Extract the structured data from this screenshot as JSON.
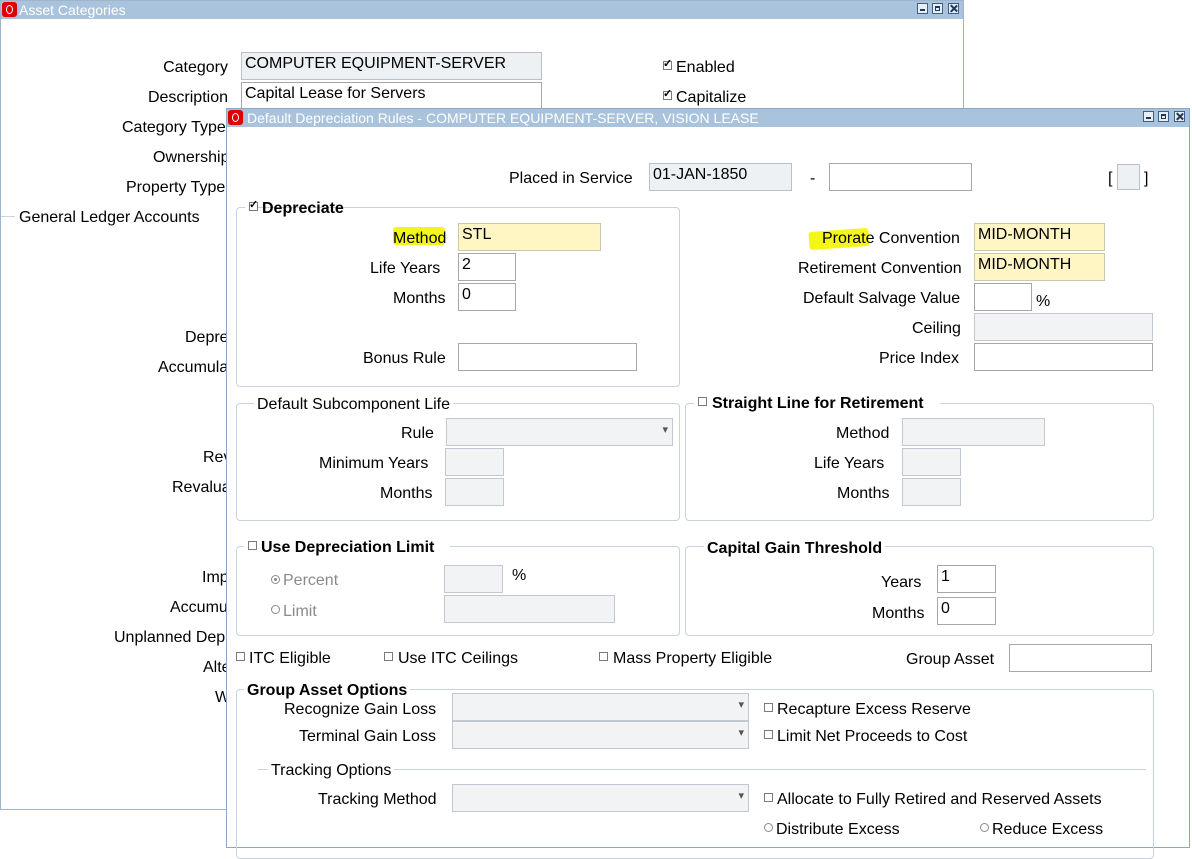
{
  "background_window": {
    "title": "Asset Categories",
    "fields": {
      "category_label": "Category",
      "category_value": "COMPUTER EQUIPMENT-SERVER",
      "description_label": "Description",
      "description_value": "Capital Lease for Servers",
      "category_type_label": "Category Type",
      "ownership_label": "Ownership",
      "property_type_label": "Property Type",
      "enabled_label": "Enabled",
      "capitalize_label": "Capitalize"
    },
    "section_general_ledger": "General Ledger Accounts",
    "partial_labels": [
      "Depre",
      "Accumula",
      "Rev",
      "Revalua",
      "Imp",
      "Accumu",
      "Unplanned Dep",
      "Alte",
      "W"
    ]
  },
  "dialog": {
    "title": "Default Depreciation Rules - COMPUTER EQUIPMENT-SERVER, VISION LEASE",
    "placed_in_service_label": "Placed in Service",
    "placed_in_service_from": "01-JAN-1850",
    "placed_in_service_sep": "-",
    "placed_in_service_to": "",
    "bracket_open": "[",
    "bracket_close": "]",
    "depreciate": {
      "label": "Depreciate",
      "checked": true,
      "method_label": "Method",
      "method_value": "STL",
      "life_years_label": "Life Years",
      "life_years_value": "2",
      "months_label": "Months",
      "months_value": "0",
      "bonus_rule_label": "Bonus Rule",
      "bonus_rule_value": ""
    },
    "prorate": {
      "prorate_label": "Prorate Convention",
      "prorate_value": "MID-MONTH",
      "retirement_label": "Retirement Convention",
      "retirement_value": "MID-MONTH",
      "salvage_label": "Default Salvage Value",
      "salvage_value": "",
      "percent_sign": "%",
      "ceiling_label": "Ceiling",
      "price_index_label": "Price Index"
    },
    "subcomponent": {
      "title": "Default Subcomponent Life",
      "rule_label": "Rule",
      "min_years_label": "Minimum Years",
      "months_label": "Months"
    },
    "straight_line": {
      "title": "Straight Line for Retirement",
      "method_label": "Method",
      "life_years_label": "Life Years",
      "months_label": "Months"
    },
    "dep_limit": {
      "title": "Use Depreciation Limit",
      "percent_label": "Percent",
      "limit_label": "Limit",
      "percent_sign": "%"
    },
    "capital_gain": {
      "title": "Capital Gain Threshold",
      "years_label": "Years",
      "years_value": "1",
      "months_label": "Months",
      "months_value": "0"
    },
    "checkboxes": {
      "itc_eligible": "ITC Eligible",
      "use_itc_ceilings": "Use ITC Ceilings",
      "mass_property": "Mass Property Eligible",
      "group_asset_label": "Group Asset"
    },
    "group_asset_options": {
      "title": "Group Asset Options",
      "recognize_label": "Recognize Gain Loss",
      "terminal_label": "Terminal Gain Loss",
      "recapture_label": "Recapture Excess Reserve",
      "limit_net_label": "Limit Net Proceeds  to Cost",
      "tracking_title": "Tracking Options",
      "tracking_method_label": "Tracking Method",
      "allocate_label": "Allocate to Fully Retired and Reserved Assets",
      "distribute_label": "Distribute Excess",
      "reduce_label": "Reduce Excess"
    }
  },
  "colors": {
    "titlebar": "#a9c3dc",
    "required_field": "#fff6c4",
    "highlight": "#f3f500",
    "oracle_red": "#e00000"
  }
}
